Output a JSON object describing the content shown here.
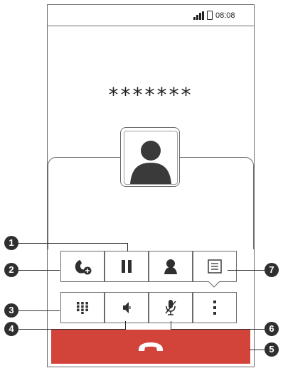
{
  "status_bar": {
    "time": "08:08"
  },
  "call": {
    "number": "*******"
  },
  "controls": {
    "row1": [
      "add-call",
      "hold",
      "contacts",
      "notes"
    ],
    "row2": [
      "dialpad",
      "speaker",
      "mute",
      "more"
    ]
  },
  "callouts": {
    "c1": "1",
    "c2": "2",
    "c3": "3",
    "c4": "4",
    "c5": "5",
    "c6": "6",
    "c7": "7"
  },
  "colors": {
    "end_call": "#d2443a",
    "frame": "#6b6b6b",
    "icon": "#2f2f2f"
  }
}
